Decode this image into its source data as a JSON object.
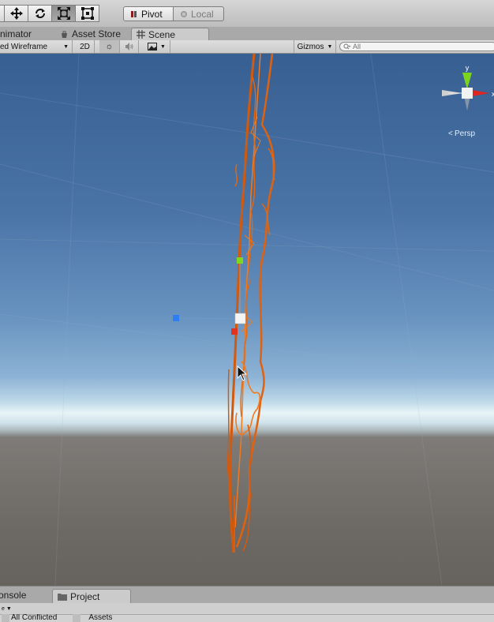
{
  "toolbar": {
    "tools": [
      {
        "name": "move-tool",
        "icon": "move-arrows-icon",
        "active": false
      },
      {
        "name": "rotate-tool",
        "icon": "rotate-icon",
        "active": false
      },
      {
        "name": "scale-tool",
        "icon": "scale-icon",
        "active": true
      },
      {
        "name": "rect-tool",
        "icon": "rect-icon",
        "active": false
      }
    ],
    "pivot_label": "Pivot",
    "local_label": "Local"
  },
  "tabs": {
    "animator": "nimator",
    "asset_store": "Asset Store",
    "scene": "Scene"
  },
  "scene_bar": {
    "shading_mode": "ed Wireframe",
    "mode_2d": "2D",
    "gizmos_label": "Gizmos",
    "search_placeholder": "All"
  },
  "viewport": {
    "persp_label": "Persp",
    "axis_y": "y",
    "axis_x": "x",
    "colors": {
      "sky_top": "#385f91",
      "horizon": "#e8f4f6",
      "ground": "#6d6965",
      "wireframe": "#e0620f",
      "handle_green": "#7fd81f",
      "handle_red": "#e23220",
      "handle_blue": "#2c7ff0",
      "gizmo_red": "#e3231d",
      "gizmo_green": "#7cd51c"
    }
  },
  "bottom": {
    "console_tab": "onsole",
    "project_tab": "Project",
    "filter_text": "All Conflicted",
    "assets_text": "Assets"
  }
}
